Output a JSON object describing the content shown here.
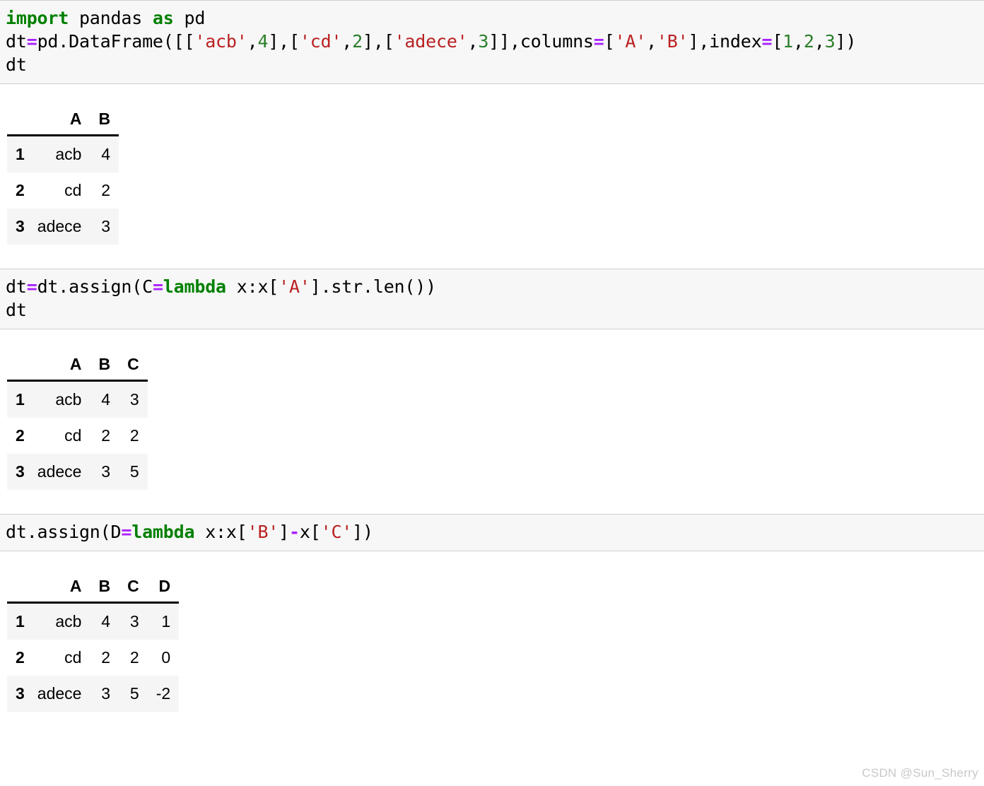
{
  "notebook": {
    "cells": [
      {
        "kind": "code",
        "name": "cell-1-import-dataframe",
        "tokens": [
          [
            {
              "t": "import",
              "c": "kw"
            },
            {
              "t": " pandas ",
              "c": "plain"
            },
            {
              "t": "as",
              "c": "kw"
            },
            {
              "t": " pd",
              "c": "plain"
            }
          ],
          [
            {
              "t": "dt",
              "c": "plain"
            },
            {
              "t": "=",
              "c": "op"
            },
            {
              "t": "pd.DataFrame([[",
              "c": "plain"
            },
            {
              "t": "'acb'",
              "c": "str"
            },
            {
              "t": ",",
              "c": "plain"
            },
            {
              "t": "4",
              "c": "num"
            },
            {
              "t": "],[",
              "c": "plain"
            },
            {
              "t": "'cd'",
              "c": "str"
            },
            {
              "t": ",",
              "c": "plain"
            },
            {
              "t": "2",
              "c": "num"
            },
            {
              "t": "],[",
              "c": "plain"
            },
            {
              "t": "'adece'",
              "c": "str"
            },
            {
              "t": ",",
              "c": "plain"
            },
            {
              "t": "3",
              "c": "num"
            },
            {
              "t": "]],columns",
              "c": "plain"
            },
            {
              "t": "=",
              "c": "op"
            },
            {
              "t": "[",
              "c": "plain"
            },
            {
              "t": "'A'",
              "c": "str"
            },
            {
              "t": ",",
              "c": "plain"
            },
            {
              "t": "'B'",
              "c": "str"
            },
            {
              "t": "],index",
              "c": "plain"
            },
            {
              "t": "=",
              "c": "op"
            },
            {
              "t": "[",
              "c": "plain"
            },
            {
              "t": "1",
              "c": "num"
            },
            {
              "t": ",",
              "c": "plain"
            },
            {
              "t": "2",
              "c": "num"
            },
            {
              "t": ",",
              "c": "plain"
            },
            {
              "t": "3",
              "c": "num"
            },
            {
              "t": "])",
              "c": "plain"
            }
          ],
          [
            {
              "t": "dt",
              "c": "plain"
            }
          ]
        ]
      },
      {
        "kind": "output",
        "name": "output-1-dataframe-ab",
        "table": {
          "index_header": "",
          "columns": [
            "A",
            "B"
          ],
          "index": [
            "1",
            "2",
            "3"
          ],
          "rows": [
            [
              "acb",
              "4"
            ],
            [
              "cd",
              "2"
            ],
            [
              "adece",
              "3"
            ]
          ]
        }
      },
      {
        "kind": "code",
        "name": "cell-2-assign-c",
        "tokens": [
          [
            {
              "t": "dt",
              "c": "plain"
            },
            {
              "t": "=",
              "c": "op"
            },
            {
              "t": "dt.assign(C",
              "c": "plain"
            },
            {
              "t": "=",
              "c": "op"
            },
            {
              "t": "lambda",
              "c": "kw"
            },
            {
              "t": " x:x[",
              "c": "plain"
            },
            {
              "t": "'A'",
              "c": "str"
            },
            {
              "t": "].str.len())",
              "c": "plain"
            }
          ],
          [
            {
              "t": "dt",
              "c": "plain"
            }
          ]
        ]
      },
      {
        "kind": "output",
        "name": "output-2-dataframe-abc",
        "table": {
          "index_header": "",
          "columns": [
            "A",
            "B",
            "C"
          ],
          "index": [
            "1",
            "2",
            "3"
          ],
          "rows": [
            [
              "acb",
              "4",
              "3"
            ],
            [
              "cd",
              "2",
              "2"
            ],
            [
              "adece",
              "3",
              "5"
            ]
          ]
        }
      },
      {
        "kind": "code",
        "name": "cell-3-assign-d",
        "tokens": [
          [
            {
              "t": "dt.assign(D",
              "c": "plain"
            },
            {
              "t": "=",
              "c": "op"
            },
            {
              "t": "lambda",
              "c": "kw"
            },
            {
              "t": " x:x[",
              "c": "plain"
            },
            {
              "t": "'B'",
              "c": "str"
            },
            {
              "t": "]",
              "c": "plain"
            },
            {
              "t": "-",
              "c": "op"
            },
            {
              "t": "x[",
              "c": "plain"
            },
            {
              "t": "'C'",
              "c": "str"
            },
            {
              "t": "])",
              "c": "plain"
            }
          ]
        ]
      },
      {
        "kind": "output",
        "name": "output-3-dataframe-abcd",
        "table": {
          "index_header": "",
          "columns": [
            "A",
            "B",
            "C",
            "D"
          ],
          "index": [
            "1",
            "2",
            "3"
          ],
          "rows": [
            [
              "acb",
              "4",
              "3",
              "1"
            ],
            [
              "cd",
              "2",
              "2",
              "0"
            ],
            [
              "adece",
              "3",
              "5",
              "-2"
            ]
          ]
        }
      }
    ]
  },
  "watermark": {
    "text": "CSDN @Sun_Sherry"
  },
  "colors": {
    "keyword": "#008000",
    "string": "#ba2121",
    "number": "#2a7f2a",
    "operator": "#aa22ff",
    "cell_background": "#f7f7f7",
    "cell_border": "#cfcfcf",
    "row_stripe": "#f5f5f5",
    "watermark": "#c8c8c8"
  }
}
